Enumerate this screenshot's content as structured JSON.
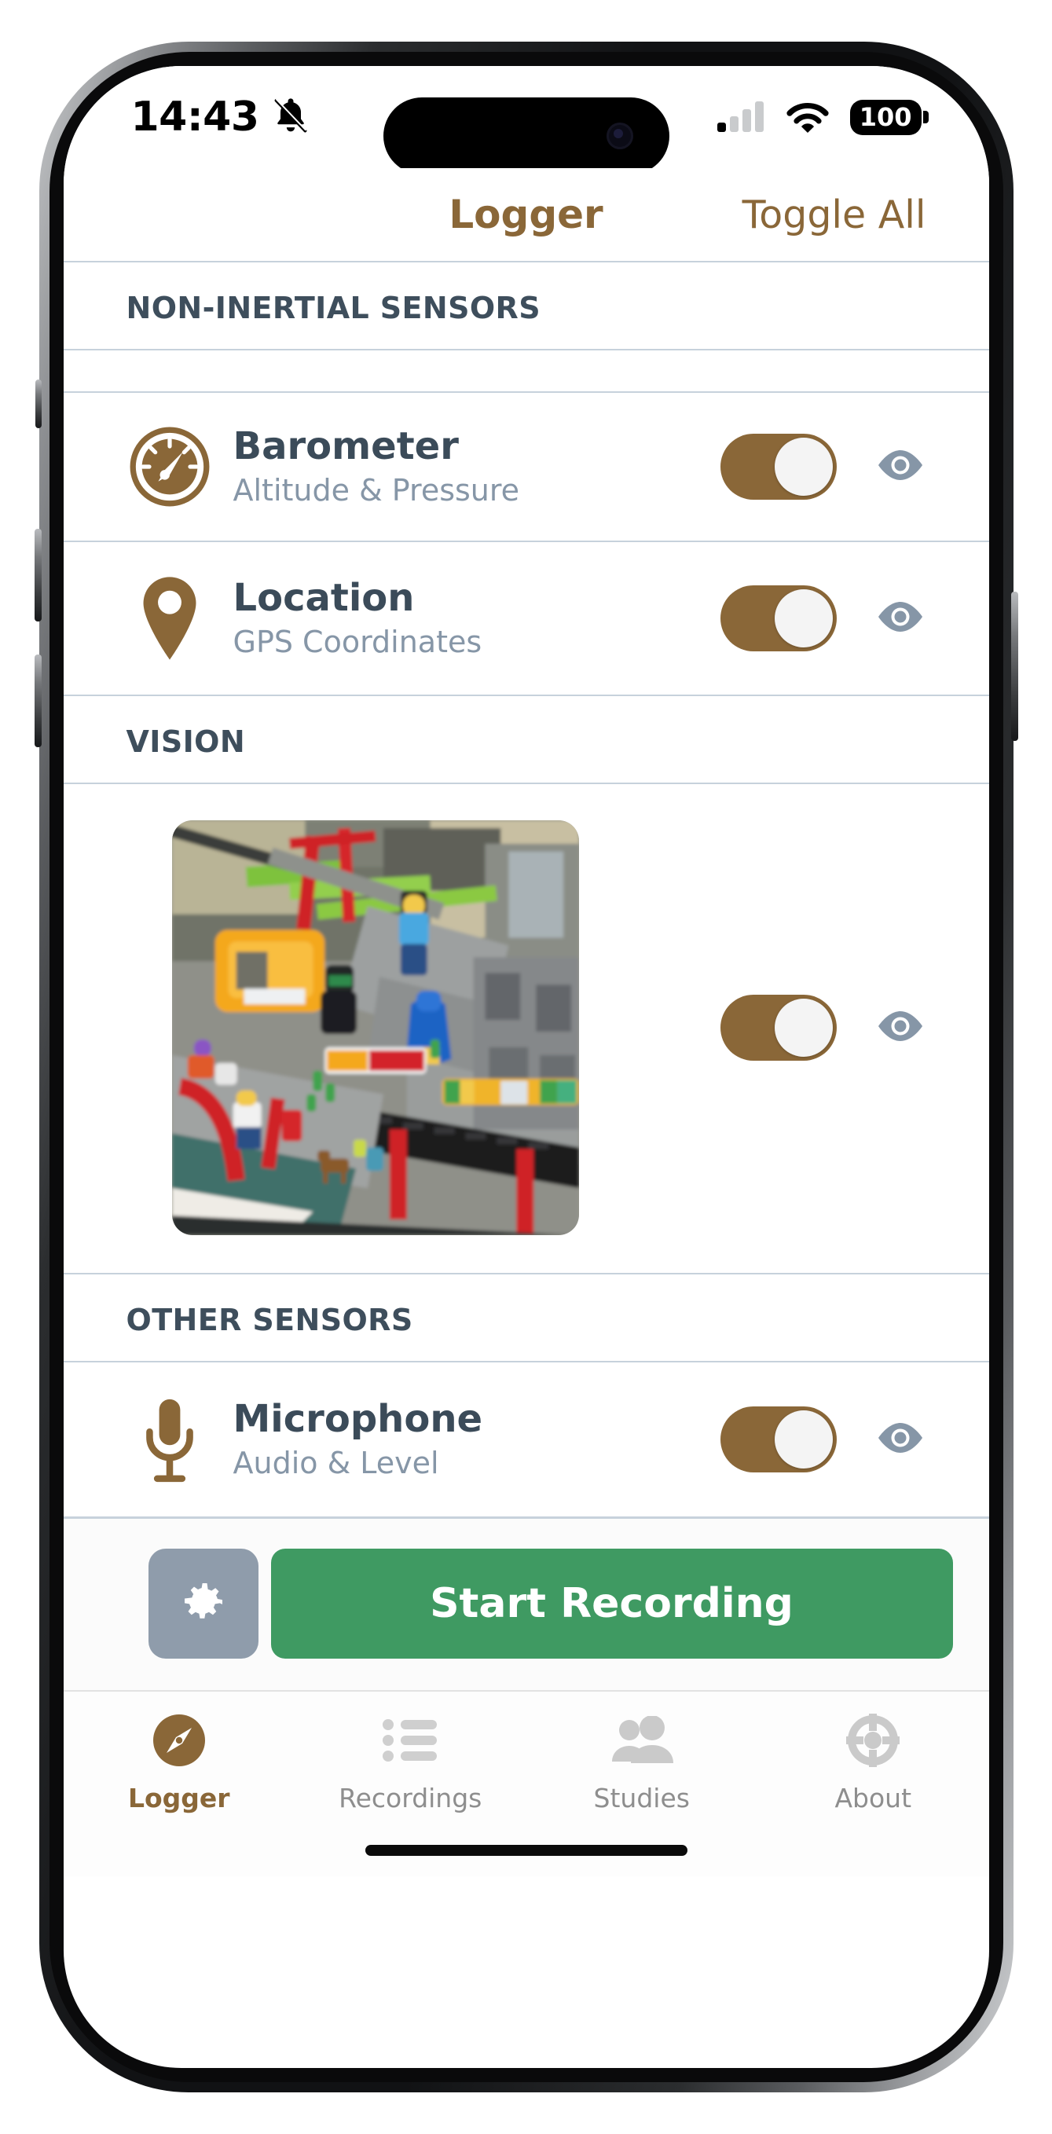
{
  "status_bar": {
    "time": "14:43",
    "silent_icon": "bell-slash-icon",
    "cellular_icon": "cellular-signal-icon",
    "wifi_icon": "wifi-icon",
    "battery_level": "100"
  },
  "nav": {
    "title": "Logger",
    "action_label": "Toggle All",
    "accent_color": "#8a6738"
  },
  "sections": [
    {
      "header": "NON-INERTIAL SENSORS",
      "rows": [
        {
          "icon": "barometer-gauge-icon",
          "title": "Barometer",
          "subtitle": "Altitude & Pressure",
          "toggle_state": "on",
          "eye_icon": "eye-icon"
        },
        {
          "icon": "location-pin-icon",
          "title": "Location",
          "subtitle": "GPS Coordinates",
          "toggle_state": "on",
          "eye_icon": "eye-icon"
        }
      ]
    },
    {
      "header": "VISION",
      "rows": [
        {
          "icon": "camera-preview-thumbnail",
          "title": "",
          "subtitle": "",
          "toggle_state": "on",
          "eye_icon": "eye-icon"
        }
      ]
    },
    {
      "header": "OTHER SENSORS",
      "rows": [
        {
          "icon": "microphone-icon",
          "title": "Microphone",
          "subtitle": "Audio & Level",
          "toggle_state": "on",
          "eye_icon": "eye-icon"
        }
      ]
    }
  ],
  "action_bar": {
    "settings_icon": "gear-icon",
    "record_label": "Start Recording",
    "record_color": "#3f9a62",
    "settings_color": "#8f9cab"
  },
  "tabbar": {
    "items": [
      {
        "label": "Logger",
        "icon": "compass-icon",
        "active": true
      },
      {
        "label": "Recordings",
        "icon": "list-icon",
        "active": false
      },
      {
        "label": "Studies",
        "icon": "people-icon",
        "active": false
      },
      {
        "label": "About",
        "icon": "life-ring-icon",
        "active": false
      }
    ]
  },
  "colors": {
    "accent_brown": "#8a6738",
    "title_slate": "#3b4b59",
    "subtitle_gray": "#8696a7",
    "hairline": "#c7d2dc"
  }
}
